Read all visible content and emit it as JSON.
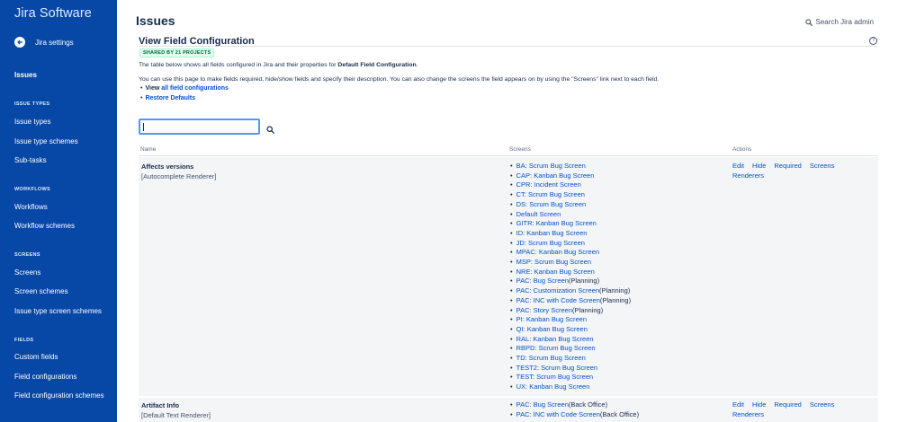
{
  "app": {
    "brand": "Jira Software"
  },
  "sidebar": {
    "back_label": "Jira settings",
    "top_item": "Issues",
    "sections": {
      "issue_types": {
        "heading": "ISSUE TYPES",
        "items": [
          "Issue types",
          "Issue type schemes",
          "Sub-tasks"
        ]
      },
      "workflows": {
        "heading": "WORKFLOWS",
        "items": [
          "Workflows",
          "Workflow schemes"
        ]
      },
      "screens": {
        "heading": "SCREENS",
        "items": [
          "Screens",
          "Screen schemes",
          "Issue type screen schemes"
        ]
      },
      "fields": {
        "heading": "FIELDS",
        "items": [
          "Custom fields",
          "Field configurations",
          "Field configuration schemes"
        ]
      }
    }
  },
  "header": {
    "title": "Issues",
    "search_admin": "Search Jira admin"
  },
  "content": {
    "title": "View Field Configuration",
    "badge": "SHARED BY 21 PROJECTS",
    "intro_prefix": "The table below shows all fields configured in Jira and their properties for ",
    "intro_bold": "Default Field Configuration",
    "intro_suffix": ".",
    "description": "You can use this page to make fields required, hide/show fields and specify their description. You can also change the screens the field appears on by using the \"Screens\" link next to each field.",
    "link1_prefix": "View ",
    "link1": "all field configurations",
    "link2": "Restore Defaults",
    "filter": {
      "value": "",
      "placeholder": ""
    }
  },
  "table": {
    "columns": {
      "name": "Name",
      "screens": "Screens",
      "actions": "Actions"
    },
    "rows": [
      {
        "name": "Affects versions",
        "renderer": "[Autocomplete Renderer]",
        "screens": [
          {
            "link": "BA: Scrum Bug Screen",
            "suffix": ""
          },
          {
            "link": "CAP: Kanban Bug Screen",
            "suffix": ""
          },
          {
            "link": "CPR: Incident Screen",
            "suffix": ""
          },
          {
            "link": "CT: Scrum Bug Screen",
            "suffix": ""
          },
          {
            "link": "DS: Scrum Bug Screen",
            "suffix": ""
          },
          {
            "link": "Default Screen",
            "suffix": ""
          },
          {
            "link": "GITR: Kanban Bug Screen",
            "suffix": ""
          },
          {
            "link": "ID: Kanban Bug Screen",
            "suffix": ""
          },
          {
            "link": "JD: Scrum Bug Screen",
            "suffix": ""
          },
          {
            "link": "MPAC: Kanban Bug Screen",
            "suffix": ""
          },
          {
            "link": "MSP: Scrum Bug Screen",
            "suffix": ""
          },
          {
            "link": "NRE: Kanban Bug Screen",
            "suffix": ""
          },
          {
            "link": "PAC: Bug Screen",
            "suffix": "(Planning)"
          },
          {
            "link": "PAC: Customization Screen",
            "suffix": "(Planning)"
          },
          {
            "link": "PAC: INC with Code Screen",
            "suffix": "(Planning)"
          },
          {
            "link": "PAC: Story Screen",
            "suffix": "(Planning)"
          },
          {
            "link": "PI: Kanban Bug Screen",
            "suffix": ""
          },
          {
            "link": "QI: Kanban Bug Screen",
            "suffix": ""
          },
          {
            "link": "RAL: Kanban Bug Screen",
            "suffix": ""
          },
          {
            "link": "RBPD: Scrum Bug Screen",
            "suffix": ""
          },
          {
            "link": "TD: Scrum Bug Screen",
            "suffix": ""
          },
          {
            "link": "TEST2: Scrum Bug Screen",
            "suffix": ""
          },
          {
            "link": "TEST: Scrum Bug Screen",
            "suffix": ""
          },
          {
            "link": "UX: Kanban Bug Screen",
            "suffix": ""
          }
        ],
        "actions": [
          "Edit",
          "Hide",
          "Required",
          "Screens",
          "Renderers"
        ]
      },
      {
        "name": "Artifact Info",
        "renderer": "[Default Text Renderer]",
        "screens": [
          {
            "link": "PAC: Bug Screen",
            "suffix": "(Back Office)"
          },
          {
            "link": "PAC: INC with Code Screen",
            "suffix": "(Back Office)"
          }
        ],
        "actions": [
          "Edit",
          "Hide",
          "Required",
          "Screens",
          "Renderers"
        ]
      }
    ]
  },
  "colors": {
    "sidebar_bg": "#0747a6",
    "link": "#0052cc",
    "badge_bg": "#e3fcef",
    "badge_text": "#006644",
    "row_bg": "#f4f5f7",
    "focus": "#4c9aff"
  },
  "icons": {
    "back": "arrow-left-circle-icon",
    "search": "search-icon",
    "help": "help-circle-icon"
  }
}
